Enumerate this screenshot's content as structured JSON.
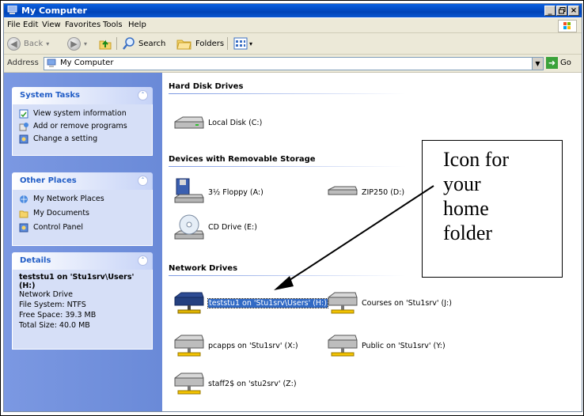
{
  "window": {
    "title": "My Computer",
    "controls": [
      "_",
      "×"
    ]
  },
  "menubar": {
    "items": [
      {
        "label": "File"
      },
      {
        "label": "Edit"
      },
      {
        "label": "View"
      },
      {
        "label": "Favorites"
      },
      {
        "label": "Tools"
      },
      {
        "label": "Help"
      }
    ]
  },
  "toolbar": {
    "back_label": "Back",
    "search_label": "Search",
    "folders_label": "Folders"
  },
  "address": {
    "label": "Address",
    "value": "My Computer",
    "go_label": "Go"
  },
  "taskpane": {
    "system_tasks": {
      "title": "System Tasks",
      "items": [
        {
          "label": "View system information",
          "icon": "info-icon"
        },
        {
          "label": "Add or remove programs",
          "icon": "programs-icon"
        },
        {
          "label": "Change a setting",
          "icon": "control-panel-icon"
        }
      ]
    },
    "other_places": {
      "title": "Other Places",
      "items": [
        {
          "label": "My Network Places",
          "icon": "network-places-icon"
        },
        {
          "label": "My Documents",
          "icon": "folder-icon"
        },
        {
          "label": "Control Panel",
          "icon": "control-panel-icon"
        }
      ]
    },
    "details": {
      "title": "Details",
      "name": "teststu1 on 'Stu1srv\\Users' (H:)",
      "type": "Network Drive",
      "file_system": "File System: NTFS",
      "free_space": "Free Space: 39.3 MB",
      "total_size": "Total Size: 40.0 MB"
    }
  },
  "content": {
    "groups": [
      {
        "title": "Hard Disk Drives"
      },
      {
        "title": "Devices with Removable Storage"
      },
      {
        "title": "Network Drives"
      }
    ],
    "hard_disks": [
      {
        "label": "Local Disk (C:)"
      }
    ],
    "removable": [
      {
        "label": "3½ Floppy (A:)"
      },
      {
        "label": "ZIP250 (D:)"
      },
      {
        "label": "CD Drive (E:)"
      }
    ],
    "network": [
      {
        "label": "teststu1 on 'Stu1srv\\Users' (H:)",
        "selected": true
      },
      {
        "label": "Courses on 'Stu1srv' (J:)"
      },
      {
        "label": "pcapps on 'Stu1srv' (X:)"
      },
      {
        "label": "Public on 'Stu1srv' (Y:)"
      },
      {
        "label": "staff2$ on 'stu2srv' (Z:)"
      }
    ]
  },
  "callout": {
    "lines": [
      "Icon for",
      "your",
      "home",
      "folder"
    ]
  },
  "colors": {
    "titlebar": "#0043b8",
    "taskpane": "#7b98e2",
    "selection": "#316ac5"
  }
}
